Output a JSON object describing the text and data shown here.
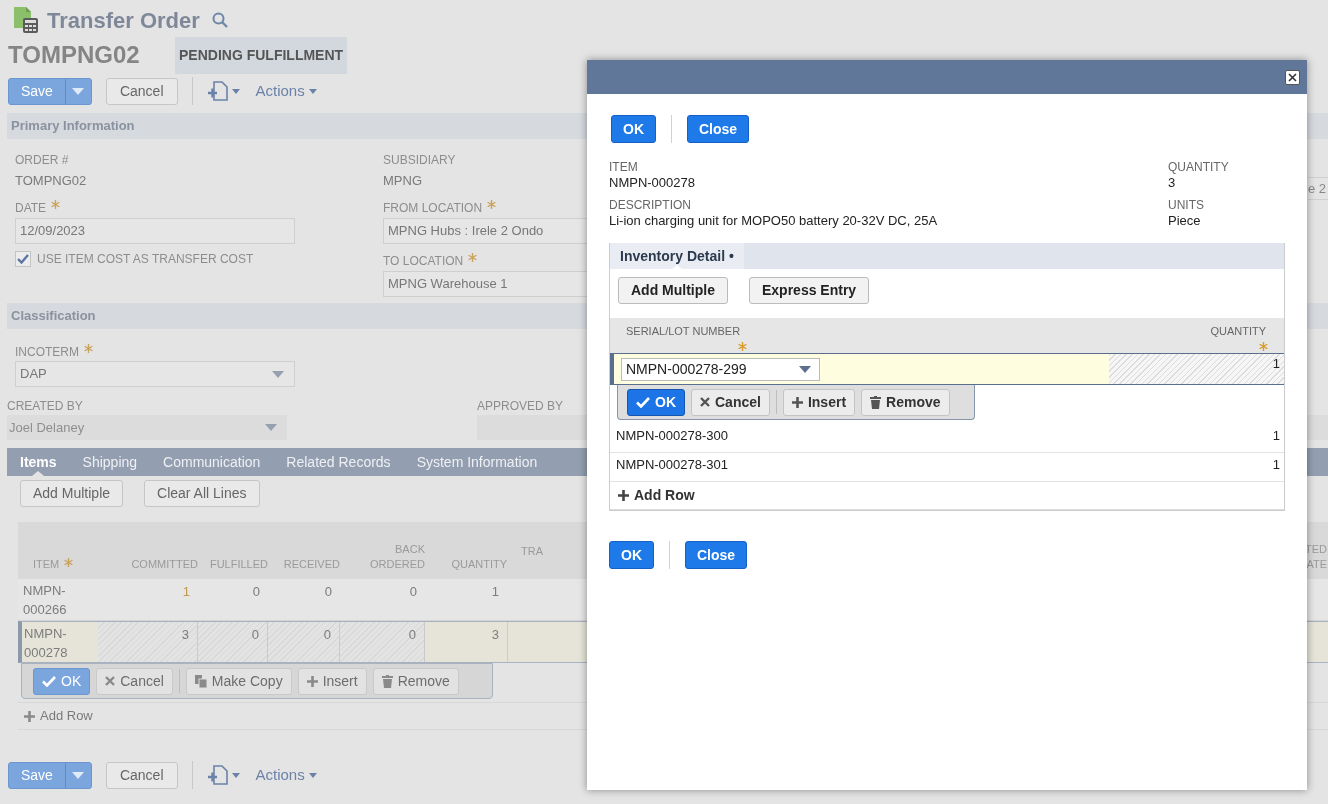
{
  "page": {
    "record_type": "Transfer Order",
    "record_id": "TOMPNG02",
    "status": "PENDING FULFILLMENT",
    "toolbar": {
      "save": "Save",
      "cancel": "Cancel",
      "actions": "Actions"
    },
    "primary_information": {
      "title": "Primary Information",
      "columns": [
        [
          {
            "kind": "text",
            "label": "ORDER #",
            "value": "TOMPNG02"
          },
          {
            "kind": "input",
            "label": "DATE",
            "required": true,
            "value": "12/09/2023"
          },
          {
            "kind": "checkbox",
            "label": "USE ITEM COST AS TRANSFER COST",
            "checked": true
          }
        ],
        [
          {
            "kind": "text",
            "label": "SUBSIDIARY",
            "value": "MPNG"
          },
          {
            "kind": "input",
            "label": "FROM LOCATION",
            "required": true,
            "value": "MPNG Hubs : Irele 2 Ondo"
          },
          {
            "kind": "input",
            "label": "TO LOCATION",
            "required": true,
            "value": "MPNG Warehouse 1"
          }
        ]
      ],
      "column_3_fragment": "e 2"
    },
    "classification": {
      "title": "Classification",
      "incoterm": {
        "label": "INCOTERM",
        "required": true,
        "value": "DAP"
      },
      "created_by": {
        "label": "CREATED BY",
        "value": "Joel Delaney",
        "disabled": true
      },
      "approved_by": {
        "label": "APPROVED BY",
        "disabled": true
      }
    },
    "tabs": [
      {
        "label": "Items",
        "selected": true
      },
      {
        "label": "Shipping",
        "selected": false
      },
      {
        "label": "Communication",
        "selected": false
      },
      {
        "label": "Related Records",
        "selected": false
      },
      {
        "label": "System Information",
        "selected": false
      }
    ],
    "items": {
      "buttons": [
        "Add Multiple",
        "Clear All Lines"
      ],
      "columns": [
        {
          "label": "ITEM",
          "required": true
        },
        {
          "label": "COMMITTED"
        },
        {
          "label": "FULFILLED"
        },
        {
          "label": "RECEIVED"
        },
        {
          "label": "BACK ORDERED"
        },
        {
          "label": "QUANTITY"
        },
        {
          "label": "TRA"
        }
      ],
      "last_column_fragment": [
        "TED",
        "ATE"
      ],
      "rows": [
        {
          "item": "NMPN-000266",
          "values": [
            "1",
            "0",
            "0",
            "0",
            "1"
          ],
          "editing": false
        },
        {
          "item": "NMPN-000278",
          "values": [
            "3",
            "0",
            "0",
            "0",
            "3"
          ],
          "editing": true
        }
      ],
      "row_actions": [
        "OK",
        "Cancel",
        "Make Copy",
        "Insert",
        "Remove"
      ],
      "add_row": "Add Row"
    },
    "bottom_toolbar": {
      "save": "Save",
      "cancel": "Cancel",
      "actions": "Actions"
    }
  },
  "dialog": {
    "buttons": [
      "OK",
      "Close"
    ],
    "fields": [
      {
        "label": "ITEM",
        "value": "NMPN-000278"
      },
      {
        "label": "QUANTITY",
        "value": "3"
      },
      {
        "label": "DESCRIPTION",
        "value": "Li-ion charging unit for MOPO50 battery 20-32V DC, 25A"
      },
      {
        "label": "UNITS",
        "value": "Piece"
      }
    ],
    "subtab": "Inventory Detail •",
    "detail_buttons": [
      "Add Multiple",
      "Express Entry"
    ],
    "columns": [
      {
        "label": "SERIAL/LOT NUMBER",
        "required": true
      },
      {
        "label": "QUANTITY",
        "required": true
      }
    ],
    "rows": [
      {
        "serial": "NMPN-000278-299",
        "quantity": "1",
        "editing": true
      },
      {
        "serial": "NMPN-000278-300",
        "quantity": "1",
        "editing": false
      },
      {
        "serial": "NMPN-000278-301",
        "quantity": "1",
        "editing": false
      }
    ],
    "row_actions": [
      "OK",
      "Cancel",
      "Insert",
      "Remove"
    ],
    "add_row": "Add Row",
    "bottom_buttons": [
      "OK",
      "Close"
    ]
  }
}
